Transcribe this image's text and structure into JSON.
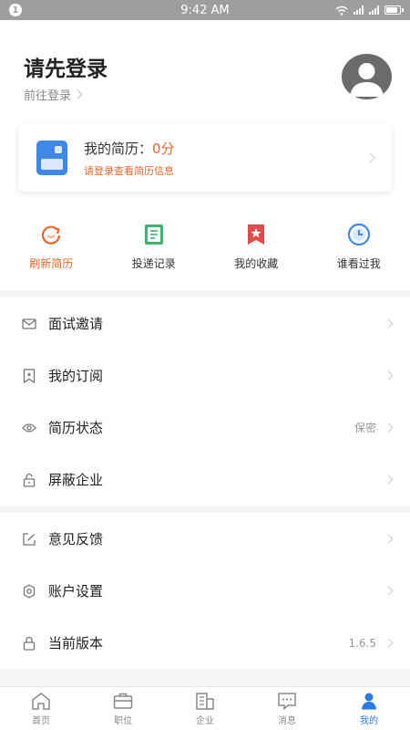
{
  "status_bar": {
    "notification_badge": "1",
    "time": "9:42 AM"
  },
  "profile": {
    "title": "请先登录",
    "subtitle": "前往登录"
  },
  "resume_card": {
    "title": "我的简历：",
    "score": "0分",
    "hint": "请登录查看简历信息"
  },
  "quick_actions": [
    {
      "label": "刷新简历",
      "icon": "refresh-icon",
      "color": "#e8642d"
    },
    {
      "label": "投递记录",
      "icon": "document-list-icon",
      "color": "#3cb371"
    },
    {
      "label": "我的收藏",
      "icon": "star-bookmark-icon",
      "color": "#e04b4b"
    },
    {
      "label": "谁看过我",
      "icon": "clock-icon",
      "color": "#3f88e8"
    }
  ],
  "menu_group_1": [
    {
      "label": "面试邀请",
      "value": "",
      "icon": "mail-icon"
    },
    {
      "label": "我的订阅",
      "value": "",
      "icon": "bookmark-plus-icon"
    },
    {
      "label": "简历状态",
      "value": "保密",
      "icon": "eye-icon"
    },
    {
      "label": "屏蔽企业",
      "value": "",
      "icon": "unlock-icon"
    }
  ],
  "menu_group_2": [
    {
      "label": "意见反馈",
      "value": "",
      "icon": "edit-icon"
    },
    {
      "label": "账户设置",
      "value": "",
      "icon": "gear-icon"
    },
    {
      "label": "当前版本",
      "value": "1.6.5",
      "icon": "lock-icon"
    }
  ],
  "tabs": [
    {
      "label": "首页",
      "icon": "home-icon"
    },
    {
      "label": "职位",
      "icon": "briefcase-icon"
    },
    {
      "label": "企业",
      "icon": "building-icon"
    },
    {
      "label": "消息",
      "icon": "chat-icon"
    },
    {
      "label": "我的",
      "icon": "user-icon"
    }
  ],
  "colors": {
    "accent_orange": "#e8642d",
    "accent_blue": "#2b7be5"
  }
}
